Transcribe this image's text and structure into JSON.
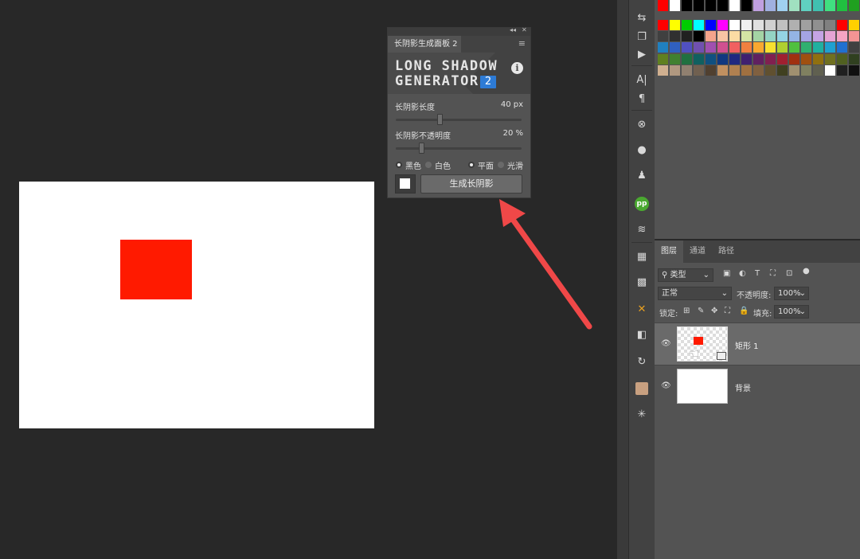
{
  "plugin": {
    "tab_title": "长阴影生成面板 2",
    "logo_line1": "LONG SHADOW",
    "logo_line2": "GENERATOR",
    "logo_version": "2",
    "length_label": "长阴影长度",
    "length_value": "40 px",
    "length_fraction": 0.35,
    "opacity_label": "长阴影不透明度",
    "opacity_value": "20 %",
    "opacity_fraction": 0.2,
    "color_options": [
      "黑色",
      "白色"
    ],
    "color_selected": "黑色",
    "style_options": [
      "平面",
      "光滑"
    ],
    "style_selected": "平面",
    "generate_label": "生成长阴影"
  },
  "canvas": {
    "shape_color": "#ff1a00",
    "background": "#ffffff"
  },
  "arrow": {
    "color": "#f04848"
  },
  "swatches": {
    "rows": [
      [
        "#ff0000",
        "#ffffff",
        "#000000",
        "#000000",
        "#000000",
        "#000000",
        "#ffffff",
        "#000000",
        "#c0a0e0",
        "#a0b0e0",
        "#a0d0f0",
        "#a0e0c0",
        "#60d0c0",
        "#40c0b0",
        "#40e080",
        "#20c040",
        "#20a020"
      ],
      [
        "#ff0000",
        "#ffff00",
        "#00cc00",
        "#00ffff",
        "#0000ff",
        "#ff00ff",
        "#ffffff",
        "#f0f0f0",
        "#e0e0e0",
        "#d0d0d0",
        "#c0c0c0",
        "#b0b0b0",
        "#a0a0a0",
        "#909090",
        "#808080",
        "#ff0000",
        "#ffd000"
      ],
      [
        "#404040",
        "#303030",
        "#202020",
        "#000000",
        "#f4a48c",
        "#f8c4a4",
        "#fcdca4",
        "#d4e4a4",
        "#a4d4a4",
        "#94d4c4",
        "#94d4e4",
        "#94b4e4",
        "#a4a4e4",
        "#c4a4e4",
        "#e4a4d4",
        "#f4a4c4",
        "#f49494"
      ],
      [
        "#2080c0",
        "#3060c0",
        "#5050c0",
        "#7050b0",
        "#a050b0",
        "#d05090",
        "#f06060",
        "#f08040",
        "#f8a830",
        "#f8e030",
        "#b0d030",
        "#50c040",
        "#30b070",
        "#20b0a0",
        "#20a0d0",
        "#2070d0",
        "#404040"
      ],
      [
        "#608020",
        "#408030",
        "#207040",
        "#106060",
        "#105080",
        "#103880",
        "#202880",
        "#402070",
        "#602060",
        "#802050",
        "#a02030",
        "#a03010",
        "#a05010",
        "#907010",
        "#707020",
        "#506020",
        "#304020"
      ],
      [
        "#d0b090",
        "#b09880",
        "#908070",
        "#706050",
        "#504030",
        "#c09060",
        "#b08050",
        "#a07040",
        "#806040",
        "#605030",
        "#404020",
        "#a09070",
        "#808060",
        "#606050",
        "#ffffff",
        "#202020",
        "#101010"
      ]
    ]
  },
  "layers": {
    "tabs": [
      "图层",
      "通道",
      "路径"
    ],
    "filter_type": "类型",
    "blend_mode": "正常",
    "opacity_label": "不透明度:",
    "opacity_value": "100%",
    "lock_label": "锁定:",
    "fill_label": "填充:",
    "fill_value": "100%",
    "items": [
      {
        "name": "矩形 1",
        "selected": true
      },
      {
        "name": "背景",
        "selected": false
      }
    ]
  },
  "toolbar": {
    "icons": [
      "panel-arrange-icon",
      "copy-icon",
      "play-icon",
      "character-icon",
      "paragraph-icon",
      "navigator-icon",
      "comment-icon",
      "clone-stamp-icon",
      "pp-plugin-icon",
      "brush-preset-icon",
      "libraries-icon",
      "pattern-icon",
      "tools-cross-icon",
      "3d-icon",
      "rotate-icon",
      "portrait-icon",
      "sparkle-icon"
    ]
  }
}
